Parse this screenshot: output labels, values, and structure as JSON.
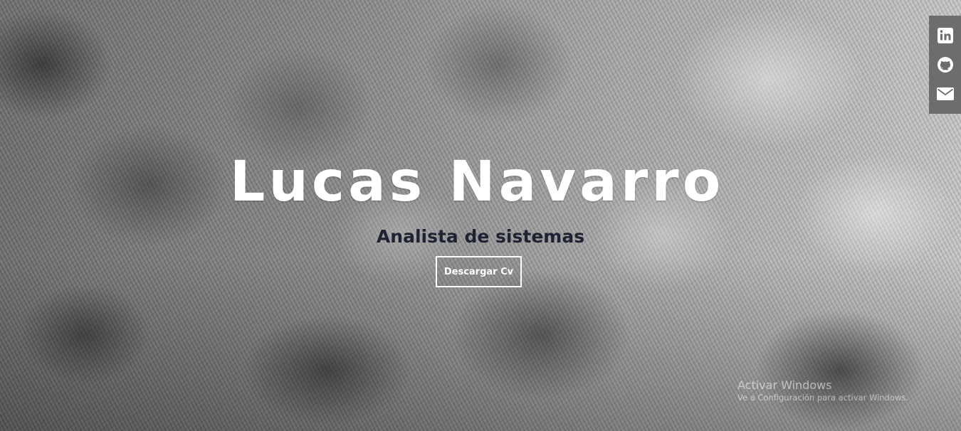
{
  "hero": {
    "name": "Lucas Navarro",
    "subtitle": "Analista de sistemas",
    "cv_button_label": "Descargar Cv"
  },
  "social_links": [
    {
      "icon": "linkedin-icon",
      "label": "LinkedIn"
    },
    {
      "icon": "github-icon",
      "label": "GitHub"
    },
    {
      "icon": "email-icon",
      "label": "Email"
    }
  ],
  "watermark": {
    "title": "Activar Windows",
    "text": "Ve a Configuración para activar Windows."
  },
  "colors": {
    "name_text": "#ffffff",
    "subtitle_text": "#1f2233",
    "social_bar_bg": "#6d6d6d"
  }
}
